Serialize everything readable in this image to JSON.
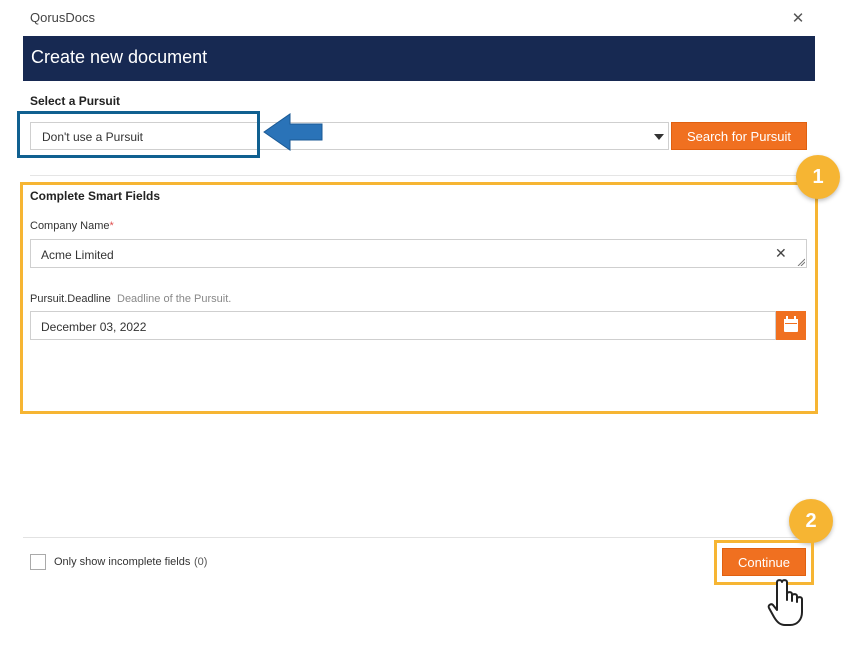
{
  "app": {
    "title": "QorusDocs"
  },
  "header": {
    "title": "Create new document"
  },
  "pursuit": {
    "section_label": "Select a Pursuit",
    "selected_value": "Don't use a Pursuit",
    "search_button_label": "Search for Pursuit"
  },
  "smart_fields": {
    "section_label": "Complete Smart Fields",
    "company": {
      "label": "Company Name",
      "required_mark": "*",
      "value": "Acme Limited"
    },
    "deadline": {
      "label": "Pursuit.Deadline",
      "hint": "Deadline of the Pursuit.",
      "value": "December 03, 2022"
    }
  },
  "footer": {
    "checkbox_label": "Only show incomplete fields",
    "incomplete_count": "(0)",
    "continue_label": "Continue"
  },
  "badges": {
    "step1": "1",
    "step2": "2"
  },
  "colors": {
    "header_bg": "#172952",
    "accent_orange": "#f07020",
    "highlight_yellow": "#f6b533",
    "highlight_blue": "#106090"
  },
  "icons": {
    "close": "close-icon",
    "dropdown": "chevron-down-icon",
    "clear": "clear-icon",
    "calendar": "calendar-icon",
    "arrow": "arrow-left-icon",
    "pointer": "hand-pointer-icon"
  }
}
